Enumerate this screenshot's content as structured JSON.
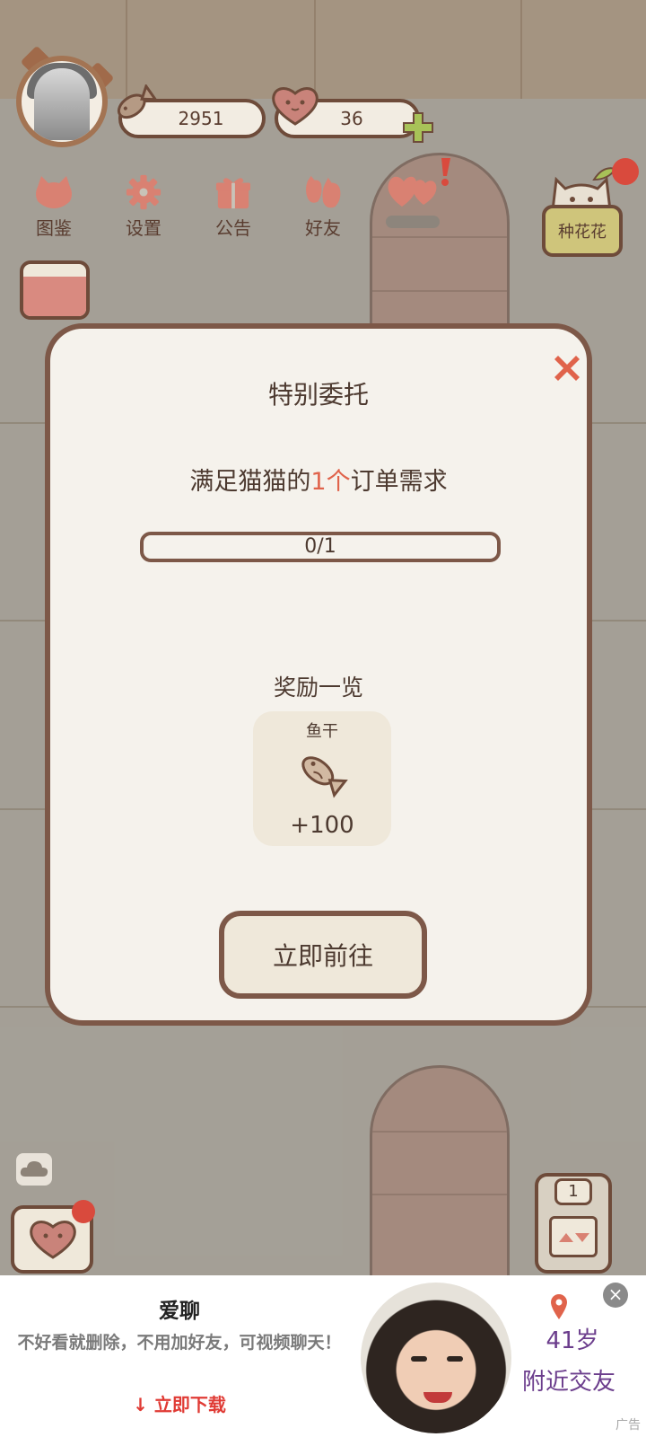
{
  "hud": {
    "fish_count": "2951",
    "heart_count": "36"
  },
  "menu": {
    "items": [
      {
        "label": "图鉴",
        "icon": "cat-head-icon"
      },
      {
        "label": "设置",
        "icon": "gear-icon"
      },
      {
        "label": "公告",
        "icon": "gift-icon"
      },
      {
        "label": "好友",
        "icon": "friends-icon"
      },
      {
        "label": "",
        "icon": "heart-task-icon"
      }
    ],
    "side_button": "种花花"
  },
  "modal": {
    "title": "特别委托",
    "desc_prefix": "满足猫猫的",
    "desc_highlight": "1个",
    "desc_suffix": "订单需求",
    "progress_text": "0/1",
    "progress_value": 0,
    "reward_heading": "奖励一览",
    "reward_name": "鱼干",
    "reward_amount": "+100",
    "go_button": "立即前往"
  },
  "game": {
    "floor_number": "1"
  },
  "ad": {
    "title": "爱聊",
    "description": "不好看就删除，不用加好友，可视频聊天！",
    "download": "立即下载",
    "age": "41岁",
    "tagline": "附近交友",
    "ad_label": "广告",
    "close": "×"
  },
  "colors": {
    "accent": "#e0634b",
    "border": "#7d5848",
    "modal_bg": "#f5f2ec",
    "ad_purple": "#6b3d8c"
  }
}
